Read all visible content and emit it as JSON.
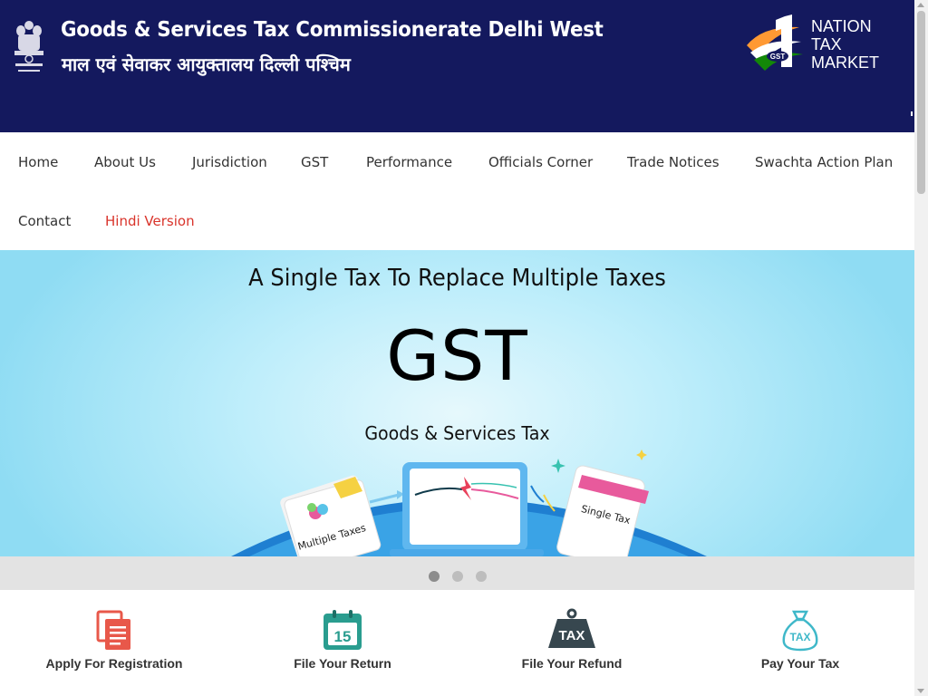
{
  "header": {
    "title": "Goods & Services Tax Commissionerate Delhi West",
    "subtitle": "माल एवं सेवाकर आयुक्तालय दिल्ली पश्चिम",
    "emblem_icon": "national-emblem-icon",
    "logo": {
      "badge": "GST",
      "lines": [
        "NATION",
        "TAX",
        "MARKET"
      ]
    }
  },
  "nav": {
    "items": [
      {
        "label": "Home"
      },
      {
        "label": "About Us"
      },
      {
        "label": "Jurisdiction"
      },
      {
        "label": "GST"
      },
      {
        "label": "Performance"
      },
      {
        "label": "Officials Corner"
      },
      {
        "label": "Trade Notices"
      },
      {
        "label": "Swachta Action Plan"
      },
      {
        "label": "Contact"
      },
      {
        "label": "Hindi Version"
      }
    ]
  },
  "banner": {
    "tagline": "A Single Tax To Replace Multiple Taxes",
    "headline": "GST",
    "subheadline": "Goods & Services Tax",
    "left_card": "Multiple Taxes",
    "right_card": "Single Tax"
  },
  "carousel": {
    "slide_count": 3,
    "active_index": 0
  },
  "services": [
    {
      "label": "Apply For Registration",
      "icon": "document-icon"
    },
    {
      "label": "File Your Return",
      "icon": "calendar-icon",
      "icon_text": "15"
    },
    {
      "label": "File Your Refund",
      "icon": "tax-weight-icon",
      "icon_text": "TAX"
    },
    {
      "label": "Pay Your Tax",
      "icon": "tax-bag-icon",
      "icon_text": "TAX"
    }
  ],
  "colors": {
    "header_bg": "#14195e",
    "accent_red": "#d9342b",
    "banner_blue": "#8fdcf3",
    "registration_icon": "#e8584a",
    "return_icon": "#2a9d8f",
    "refund_icon": "#37474f",
    "pay_icon": "#3fb8c9"
  }
}
